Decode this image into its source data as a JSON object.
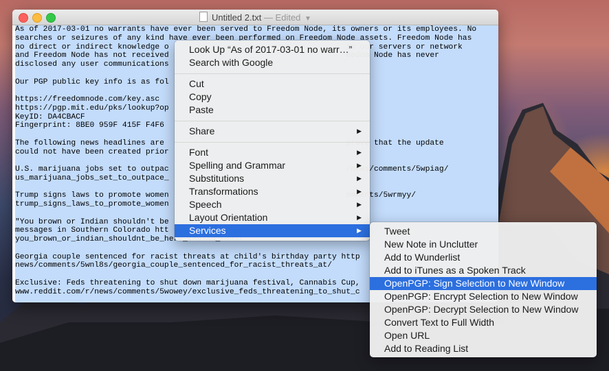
{
  "window": {
    "title": "Untitled 2.txt",
    "status": "— Edited",
    "chevron": "⌄"
  },
  "document_lines": [
    "As of 2017-03-01 no warrants have ever been served to Freedom Node, its owners or its employees. No",
    "searches or seizures of any kind have ever been performed on Freedom Node assets. Freedom Node has",
    "no direct or indirect knowledge o                                      in our servers or network",
    "and Freedom Node has not received                                      eedom Node has never",
    "disclosed any user communications",
    "",
    "Our PGP public key info is as fol",
    "",
    "https://freedomnode.com/key.asc",
    "https://pgp.mit.edu/pks/lookup?op",
    "KeyID: DA4CBACF",
    "Fingerprint: 8BE0 959F 415F F4F6",
    "",
    "The following news headlines are                                       prove that the update",
    "could not have been created prior",
    "",
    "U.S. marijuana jobs set to outpac                                      /news/comments/5wpiag/",
    "us_marijuana_jobs_set_to_outpace_",
    "",
    "Trump signs laws to promote women                                      omments/5wrmyy/",
    "trump_signs_laws_to_promote_women",
    "",
    "\"You brown or Indian shouldn't be",
    "messages in Southern Colorado htt",
    "you_brown_or_indian_shouldnt_be_here_indian_mans/",
    "",
    "Georgia couple sentenced for racist threats at child's birthday party http",
    "news/comments/5wnl8s/georgia_couple_sentenced_for_racist_threats_at/",
    "",
    "Exclusive: Feds threatening to shut down marijuana festival, Cannabis Cup,",
    "www.reddit.com/r/news/comments/5wowey/exclusive_feds_threatening_to_shut_c"
  ],
  "context_menu": {
    "look_up": "Look Up “As of 2017-03-01 no warr…”",
    "search_google": "Search with Google",
    "cut": "Cut",
    "copy": "Copy",
    "paste": "Paste",
    "share": "Share",
    "font": "Font",
    "spelling": "Spelling and Grammar",
    "substitutions": "Substitutions",
    "transformations": "Transformations",
    "speech": "Speech",
    "layout_orientation": "Layout Orientation",
    "services": "Services",
    "submenu_arrow": "▶"
  },
  "services_menu": [
    "Tweet",
    "New Note in Unclutter",
    "Add to Wunderlist",
    "Add to iTunes as a Spoken Track",
    "OpenPGP: Sign Selection to New Window",
    "OpenPGP: Encrypt Selection to New Window",
    "OpenPGP: Decrypt Selection to New Window",
    "Convert Text to Full Width",
    "Open URL",
    "Add to Reading List"
  ],
  "colors": {
    "selection_highlight": "#c3dcfb",
    "menu_selected": "#2c6fdf"
  }
}
